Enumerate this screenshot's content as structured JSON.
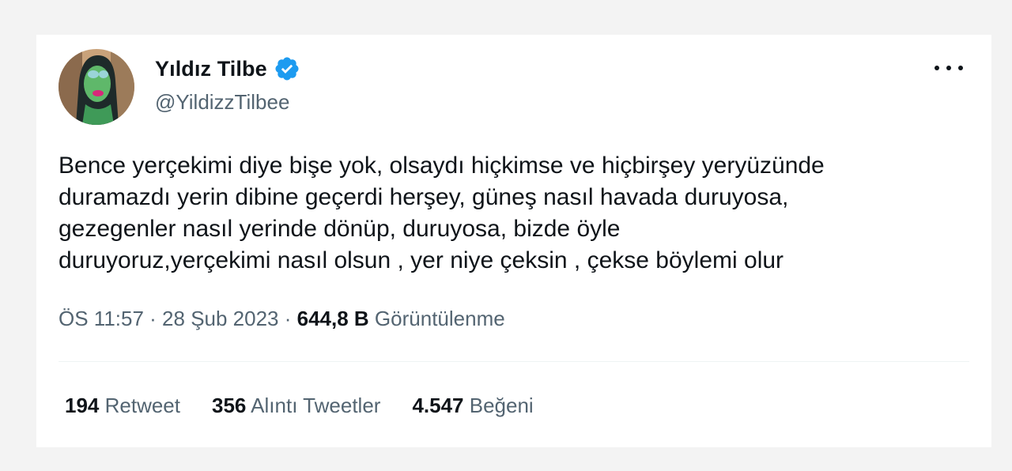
{
  "author": {
    "display_name": "Yıldız Tilbe",
    "handle": "@YildizzTilbee",
    "verified_icon": "verified-badge-icon",
    "avatar_icon": "profile-avatar"
  },
  "more_icon": "more-options-icon",
  "tweet": {
    "text": "Bence yerçekimi diye bişe yok, olsaydı hiçkimse ve hiçbirşey yeryüzünde\nduramazdı yerin dibine geçerdi herşey, güneş nasıl havada duruyosa,\ngezegenler nasıl yerinde dönüp, duruyosa, bizde öyle\nduruyoruz,yerçekimi nasıl olsun , yer niye çeksin , çekse böylemi olur"
  },
  "meta": {
    "time": "ÖS 11:57",
    "sep1": " · ",
    "date": "28 Şub 2023",
    "sep2": " · ",
    "views_count": "644,8 B",
    "views_label": " Görüntülenme"
  },
  "stats": {
    "retweets_count": "194",
    "retweets_label": " Retweet",
    "quotes_count": "356",
    "quotes_label": " Alıntı Tweetler",
    "likes_count": "4.547",
    "likes_label": " Beğeni"
  },
  "colors": {
    "verified": "#1d9bf0",
    "text_primary": "#0f1419",
    "text_secondary": "#536471"
  }
}
